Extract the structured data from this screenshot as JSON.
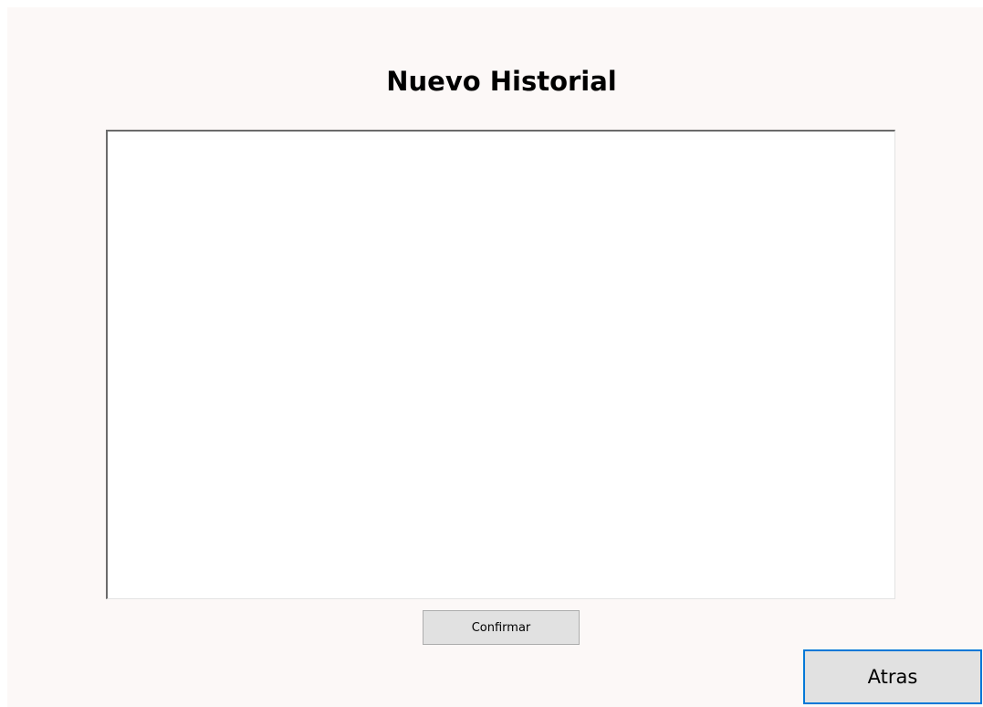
{
  "window": {
    "title": "Nuevo Historial"
  },
  "history_input": {
    "value": "",
    "placeholder": ""
  },
  "buttons": {
    "confirm_label": "Confirmar",
    "back_label": "Atras"
  },
  "colors": {
    "window_background": "#fcf8f7",
    "button_background": "#e1e1e1",
    "focus_border": "#0078d7"
  }
}
